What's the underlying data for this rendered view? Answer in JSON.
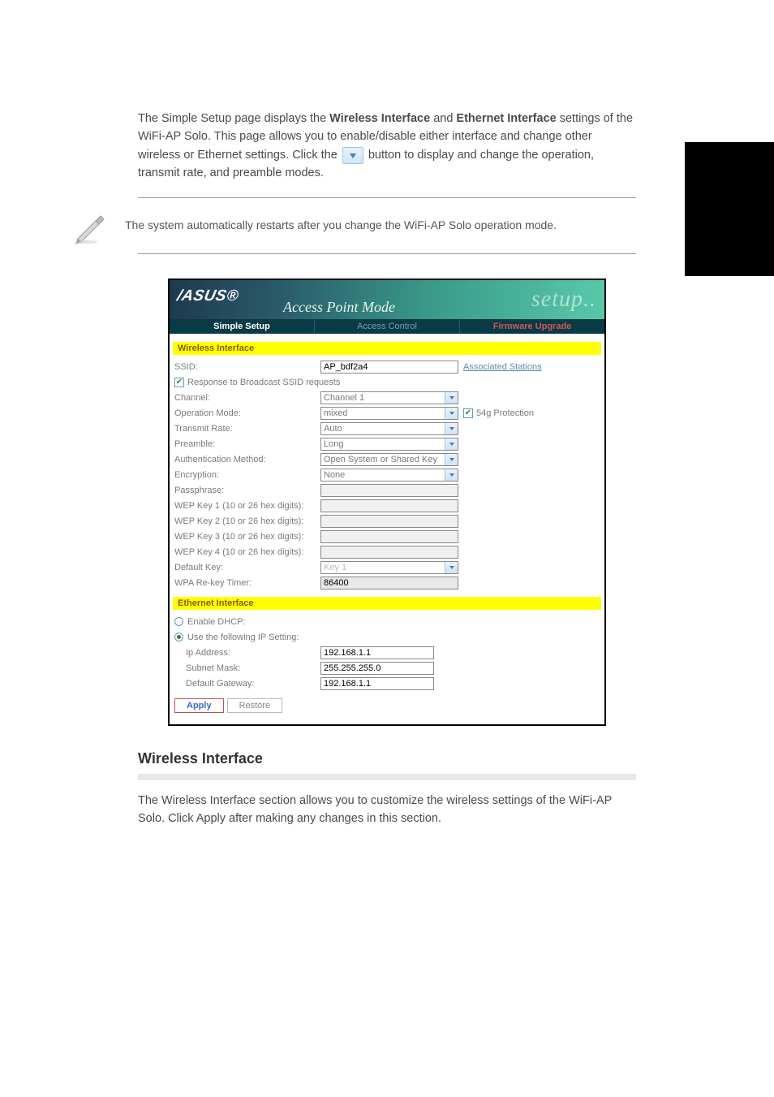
{
  "doc": {
    "intro_html": "The Simple Setup page displays the <b>Wireless Interface</b> and <b>Ethernet Interface</b> settings of the WiFi-AP Solo. This page allows you to enable/disable either interface and change other wireless or Ethernet settings. Click the    button to display and change the operation, transmit rate, and preamble modes.",
    "note": "The system automatically restarts after you change the WiFi-AP Solo operation mode.",
    "wi_heading": "Wireless Interface",
    "wi_desc": "The Wireless Interface section allows you to customize the wireless settings of the WiFi-AP Solo. Click Apply after making any changes in this section."
  },
  "shot": {
    "logo": "/ASUS",
    "ap_mode": "Access Point Mode",
    "setup_word": "setup..",
    "tabs": {
      "simple_setup": "Simple Setup",
      "access_control": "Access Control",
      "firmware_upgrade": "Firmware Upgrade"
    },
    "sections": {
      "wireless": "Wireless Interface",
      "ethernet": "Ethernet Interface"
    },
    "wireless": {
      "ssid_label": "SSID:",
      "ssid_value": "AP_bdf2a4",
      "assoc_link": "Associated Stations",
      "broadcast_label": "Response to Broadcast SSID requests",
      "channel_label": "Channel:",
      "channel_value": "Channel 1",
      "opmode_label": "Operation Mode:",
      "opmode_value": "mixed",
      "protect_label": "54g Protection",
      "txrate_label": "Transmit Rate:",
      "txrate_value": "Auto",
      "preamble_label": "Preamble:",
      "preamble_value": "Long",
      "auth_label": "Authentication Method:",
      "auth_value": "Open System or Shared Key",
      "enc_label": "Encryption:",
      "enc_value": "None",
      "pass_label": "Passphrase:",
      "wep1_label": "WEP Key 1 (10 or 26 hex digits):",
      "wep2_label": "WEP Key 2 (10 or 26 hex digits):",
      "wep3_label": "WEP Key 3 (10 or 26 hex digits):",
      "wep4_label": "WEP Key 4 (10 or 26 hex digits):",
      "defkey_label": "Default Key:",
      "defkey_value": "Key 1",
      "rekey_label": "WPA Re-key Timer:",
      "rekey_value": "86400"
    },
    "ethernet": {
      "dhcp_label": "Enable DHCP:",
      "static_label": "Use the following IP Setting:",
      "ip_label": "Ip Address:",
      "ip_value": "192.168.1.1",
      "mask_label": "Subnet Mask:",
      "mask_value": "255.255.255.0",
      "gw_label": "Default Gateway:",
      "gw_value": "192.168.1.1"
    },
    "buttons": {
      "apply": "Apply",
      "restore": "Restore"
    }
  }
}
